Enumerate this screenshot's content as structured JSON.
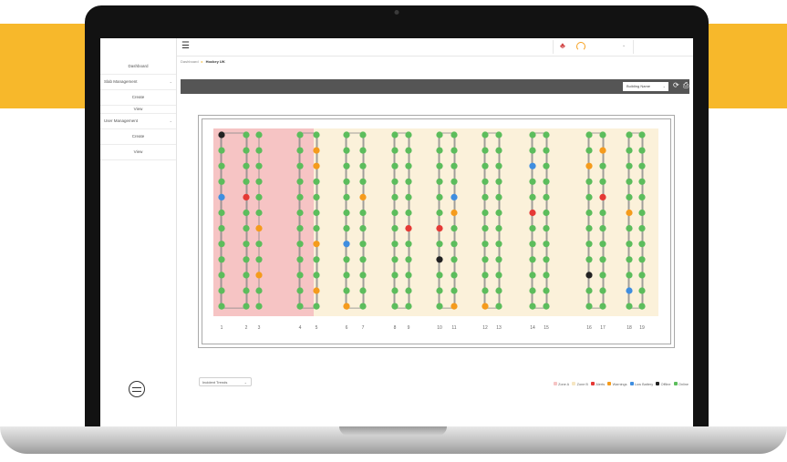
{
  "sidebar": {
    "items": [
      {
        "label": "Dashboard"
      },
      {
        "label": "Slab Management"
      },
      {
        "label": "Create"
      },
      {
        "label": "View"
      },
      {
        "label": "User Management"
      },
      {
        "label": "Create"
      },
      {
        "label": "View"
      }
    ]
  },
  "topbar": {
    "menu_icon": "hamburger-icon",
    "notification_icon": "bell-icon",
    "user_icon": "user-icon"
  },
  "breadcrumb": {
    "root": "Dashboard",
    "current": "Hockey UK"
  },
  "toolbar": {
    "building_select": "Building Name",
    "refresh_icon": "refresh-icon",
    "print_icon": "print-icon"
  },
  "bottom": {
    "select_label": "Incident Trends"
  },
  "legend": [
    {
      "label": "Zone A",
      "color": "#f6c4c4"
    },
    {
      "label": "Zone B",
      "color": "#f6e6c2"
    },
    {
      "label": "Alerts",
      "color": "#e53935"
    },
    {
      "label": "Warnings",
      "color": "#f59b1c"
    },
    {
      "label": "Low Battery",
      "color": "#3f8ee0"
    },
    {
      "label": "Offline",
      "color": "#222222"
    },
    {
      "label": "Online",
      "color": "#5cbd5c"
    }
  ],
  "colors": {
    "accent": "#f7b82b",
    "online": "#5cbd5c",
    "alert": "#e53935",
    "warning": "#f59b1c",
    "low_battery": "#3f8ee0",
    "offline": "#222222",
    "zone_a": "#f6c4c4",
    "zone_b": "#fbf1da"
  },
  "map": {
    "column_labels": [
      "1",
      "2",
      "3",
      "4",
      "5",
      "6",
      "7",
      "8",
      "9",
      "10",
      "11",
      "12",
      "13",
      "14",
      "15",
      "16",
      "17",
      "18",
      "19"
    ],
    "rows_per_column": 12,
    "status_overrides": [
      {
        "col": 1,
        "row": 0,
        "status": "offline"
      },
      {
        "col": 1,
        "row": 4,
        "status": "low_battery"
      },
      {
        "col": 2,
        "row": 4,
        "status": "alert"
      },
      {
        "col": 3,
        "row": 6,
        "status": "warning"
      },
      {
        "col": 3,
        "row": 9,
        "status": "warning"
      },
      {
        "col": 5,
        "row": 1,
        "status": "warning"
      },
      {
        "col": 5,
        "row": 2,
        "status": "warning"
      },
      {
        "col": 5,
        "row": 7,
        "status": "warning"
      },
      {
        "col": 5,
        "row": 10,
        "status": "warning"
      },
      {
        "col": 6,
        "row": 7,
        "status": "low_battery"
      },
      {
        "col": 6,
        "row": 11,
        "status": "warning"
      },
      {
        "col": 7,
        "row": 4,
        "status": "warning"
      },
      {
        "col": 9,
        "row": 6,
        "status": "alert"
      },
      {
        "col": 10,
        "row": 6,
        "status": "alert"
      },
      {
        "col": 10,
        "row": 8,
        "status": "offline"
      },
      {
        "col": 11,
        "row": 4,
        "status": "low_battery"
      },
      {
        "col": 11,
        "row": 5,
        "status": "warning"
      },
      {
        "col": 11,
        "row": 11,
        "status": "warning"
      },
      {
        "col": 12,
        "row": 11,
        "status": "warning"
      },
      {
        "col": 14,
        "row": 2,
        "status": "low_battery"
      },
      {
        "col": 14,
        "row": 5,
        "status": "alert"
      },
      {
        "col": 16,
        "row": 2,
        "status": "warning"
      },
      {
        "col": 16,
        "row": 9,
        "status": "offline"
      },
      {
        "col": 17,
        "row": 1,
        "status": "warning"
      },
      {
        "col": 17,
        "row": 4,
        "status": "alert"
      },
      {
        "col": 18,
        "row": 5,
        "status": "warning"
      },
      {
        "col": 18,
        "row": 10,
        "status": "low_battery"
      }
    ]
  }
}
